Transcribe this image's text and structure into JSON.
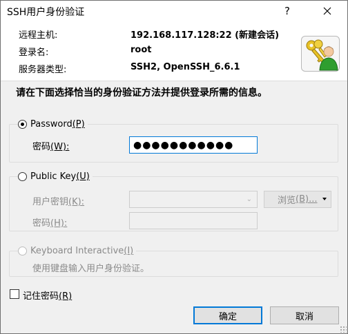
{
  "window": {
    "title": "SSH用户身份验证",
    "help_glyph": "?",
    "close_icon": "close-icon"
  },
  "info": {
    "host_label": "远程主机:",
    "host_value": "192.168.117.128:22 (新建会话)",
    "user_label": "登录名:",
    "user_value": "root",
    "server_label": "服务器类型:",
    "server_value": "SSH2, OpenSSH_6.6.1"
  },
  "instruction": "请在下面选择恰当的身份验证方法并提供登录所需的信息。",
  "password_method": {
    "label": "Password",
    "accel": "(P)",
    "selected": true,
    "field_label": "密码",
    "field_accel": "(W):",
    "field_value": "●●●●●●●●●●●"
  },
  "publickey_method": {
    "label": "Public Key",
    "accel": "(U)",
    "selected": false,
    "key_label": "用户密钥",
    "key_accel": "(K):",
    "browse_label": "浏览",
    "browse_accel": "(B)...",
    "passphrase_label": "密码",
    "passphrase_accel": "(H):"
  },
  "keyboard_method": {
    "label": "Keyboard Interactive",
    "accel": "(I)",
    "selected": false,
    "description": "使用键盘输入用户身份验证。"
  },
  "remember": {
    "label": "记住密码",
    "accel": "(R)",
    "checked": false
  },
  "buttons": {
    "ok": "确定",
    "cancel": "取消"
  },
  "colors": {
    "accent": "#0078d7",
    "panel": "#f0f0f0"
  }
}
